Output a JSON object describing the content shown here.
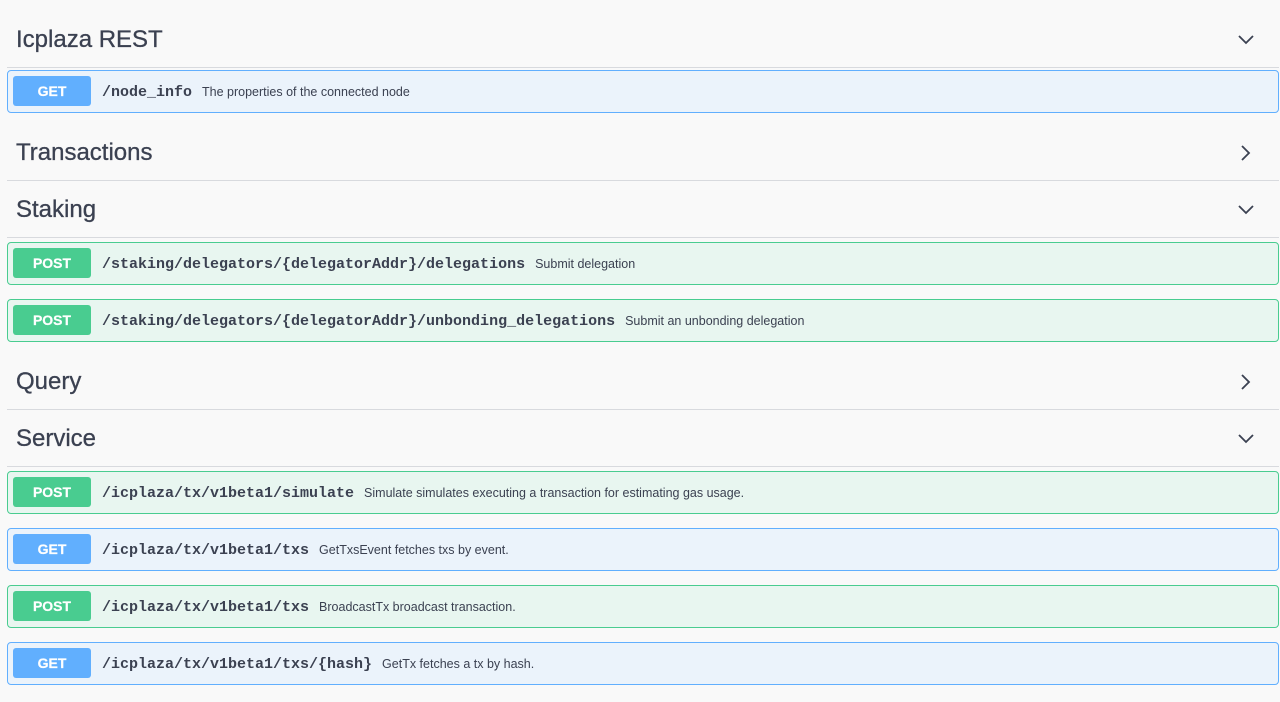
{
  "sections": [
    {
      "title": "Icplaza REST",
      "expanded": true,
      "operations": [
        {
          "method": "GET",
          "path": "/node_info",
          "description": "The properties of the connected node"
        }
      ]
    },
    {
      "title": "Transactions",
      "expanded": false,
      "operations": []
    },
    {
      "title": "Staking",
      "expanded": true,
      "operations": [
        {
          "method": "POST",
          "path": "/staking/delegators/{delegatorAddr}/delegations",
          "description": "Submit delegation"
        },
        {
          "method": "POST",
          "path": "/staking/delegators/{delegatorAddr}/unbonding_delegations",
          "description": "Submit an unbonding delegation"
        }
      ]
    },
    {
      "title": "Query",
      "expanded": false,
      "operations": []
    },
    {
      "title": "Service",
      "expanded": true,
      "operations": [
        {
          "method": "POST",
          "path": "/icplaza/tx/v1beta1/simulate",
          "description": "Simulate simulates executing a transaction for estimating gas usage."
        },
        {
          "method": "GET",
          "path": "/icplaza/tx/v1beta1/txs",
          "description": "GetTxsEvent fetches txs by event."
        },
        {
          "method": "POST",
          "path": "/icplaza/tx/v1beta1/txs",
          "description": "BroadcastTx broadcast transaction."
        },
        {
          "method": "GET",
          "path": "/icplaza/tx/v1beta1/txs/{hash}",
          "description": "GetTx fetches a tx by hash."
        }
      ]
    }
  ],
  "icons": {
    "expanded": "chevron-down-icon",
    "collapsed": "chevron-right-icon"
  },
  "colors": {
    "get_accent": "#61affe",
    "get_background": "#ebf3fb",
    "post_accent": "#49cc90",
    "post_background": "#e8f6f0",
    "text": "#3b4151"
  }
}
